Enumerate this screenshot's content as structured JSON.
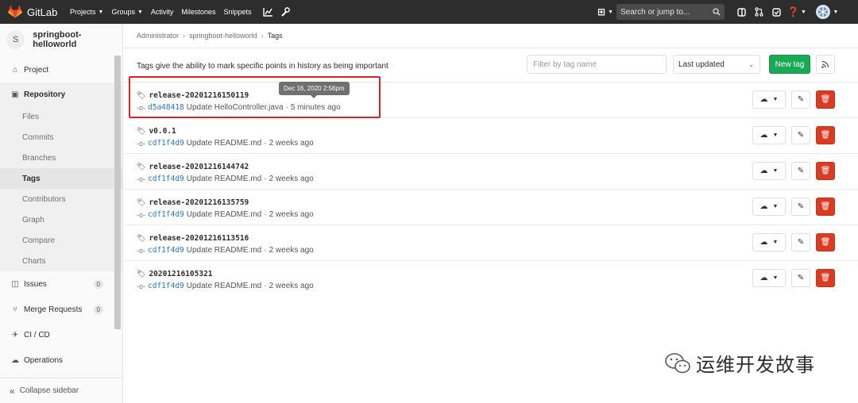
{
  "navbar": {
    "brand": "GitLab",
    "links": [
      {
        "label": "Projects",
        "caret": true
      },
      {
        "label": "Groups",
        "caret": true
      },
      {
        "label": "Activity",
        "caret": false
      },
      {
        "label": "Milestones",
        "caret": false
      },
      {
        "label": "Snippets",
        "caret": false
      }
    ],
    "search_placeholder": "Search or jump to...",
    "icons": [
      "chart-icon",
      "wrench-icon",
      "plus-icon",
      "issues-icon",
      "merge-request-icon",
      "todo-icon",
      "help-icon",
      "user-avatar"
    ]
  },
  "sidebar": {
    "project_initial": "S",
    "project_name": "springboot-helloworld",
    "items": [
      {
        "label": "Project",
        "icon": "home-icon"
      },
      {
        "label": "Repository",
        "icon": "book-icon"
      },
      {
        "label": "Issues",
        "icon": "issues-icon",
        "badge": "0"
      },
      {
        "label": "Merge Requests",
        "icon": "merge-request-icon",
        "badge": "0"
      },
      {
        "label": "CI / CD",
        "icon": "rocket-icon"
      },
      {
        "label": "Operations",
        "icon": "cloud-icon"
      }
    ],
    "repository_sub": [
      "Files",
      "Commits",
      "Branches",
      "Tags",
      "Contributors",
      "Graph",
      "Compare",
      "Charts"
    ],
    "active_sub": "Tags",
    "collapse_label": "Collapse sidebar"
  },
  "breadcrumb": {
    "items": [
      "Administrator",
      "springboot-helloworld",
      "Tags"
    ]
  },
  "main": {
    "intro": "Tags give the ability to mark specific points in history as being important",
    "filter_placeholder": "Filter by tag name",
    "sort_value": "Last updated",
    "new_tag_label": "New tag",
    "tooltip": "Dec 16, 2020 2:56pm"
  },
  "tags": [
    {
      "name": "release-20201216150119",
      "sha": "d5a48418",
      "message": "Update HelloController.java",
      "time": "5 minutes ago"
    },
    {
      "name": "v0.0.1",
      "sha": "cdf1f4d9",
      "message": "Update README.md",
      "time": "2 weeks ago"
    },
    {
      "name": "release-20201216144742",
      "sha": "cdf1f4d9",
      "message": "Update README.md",
      "time": "2 weeks ago"
    },
    {
      "name": "release-20201216135759",
      "sha": "cdf1f4d9",
      "message": "Update README.md",
      "time": "2 weeks ago"
    },
    {
      "name": "release-20201216113516",
      "sha": "cdf1f4d9",
      "message": "Update README.md",
      "time": "2 weeks ago"
    },
    {
      "name": "20201216105321",
      "sha": "cdf1f4d9",
      "message": "Update README.md",
      "time": "2 weeks ago"
    }
  ],
  "watermark": "运维开发故事",
  "colors": {
    "navbar": "#2d2d2d",
    "new_tag": "#1aaa55",
    "delete": "#db3b21",
    "link": "#1f78d1",
    "highlight": "#e02020"
  }
}
